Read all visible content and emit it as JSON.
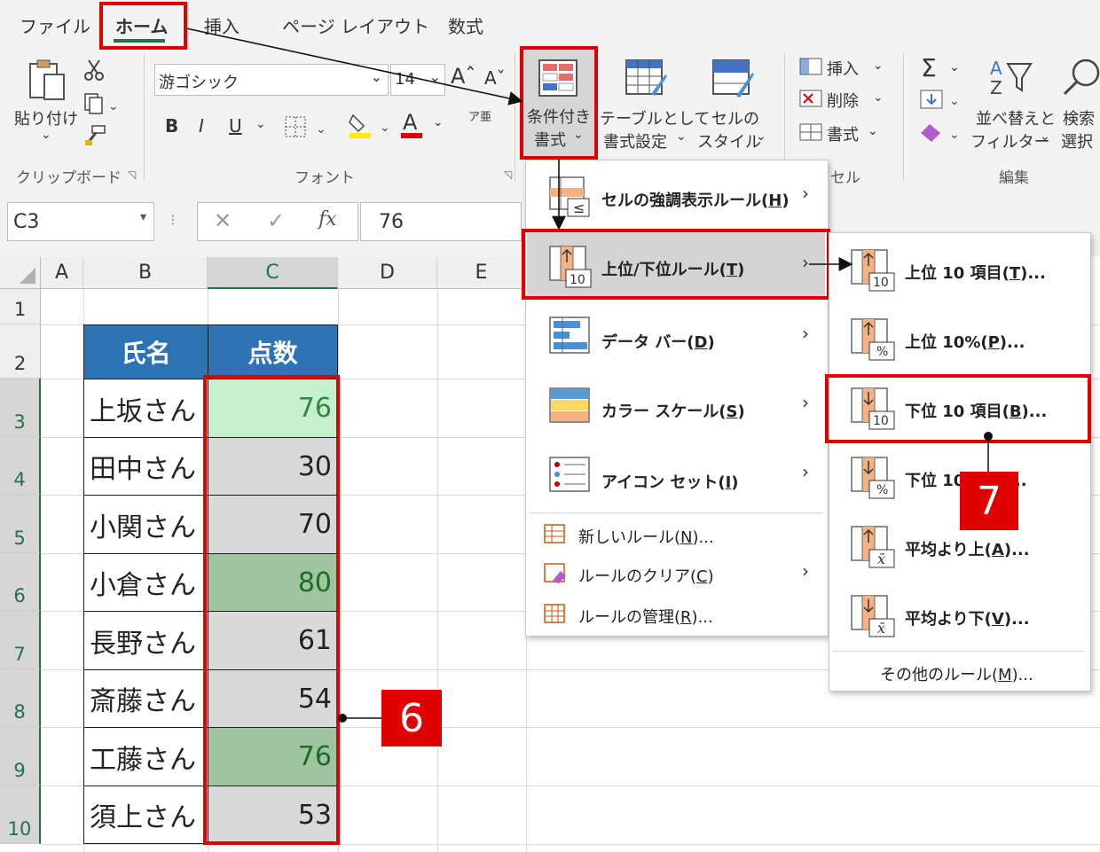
{
  "ribbon": {
    "tabs": [
      "ファイル",
      "ホーム",
      "挿入",
      "ページ レイアウト",
      "数式"
    ],
    "clipboard": {
      "paste_label": "貼り付け",
      "group_label": "クリップボード"
    },
    "font": {
      "font_name": "游ゴシック",
      "font_size": "14",
      "group_label": "フォント",
      "bold": "B",
      "italic": "I",
      "underline": "U",
      "font_color_letter": "A",
      "phonetic": "ア亜"
    },
    "styles": {
      "conditional_format_line1": "条件付き",
      "conditional_format_line2": "書式",
      "table_format_line1": "テーブルとして",
      "table_format_line2": "書式設定",
      "cell_style_line1": "セルの",
      "cell_style_line2": "スタイル"
    },
    "cells": {
      "insert": "挿入",
      "delete": "削除",
      "format": "書式",
      "group_label": "セル"
    },
    "editing": {
      "sort_line1": "並べ替えと",
      "sort_line2": "フィルター",
      "find_line1": "検索",
      "find_line2": "選択",
      "group_label": "編集"
    }
  },
  "formula_bar": {
    "name_box": "C3",
    "fx": "fx",
    "value": "76"
  },
  "columns": [
    "A",
    "B",
    "C",
    "D",
    "E"
  ],
  "rows": [
    "1",
    "2",
    "3",
    "4",
    "5",
    "6",
    "7",
    "8",
    "9",
    "10"
  ],
  "table": {
    "headers": [
      "氏名",
      "点数"
    ],
    "rows": [
      {
        "name": "上坂さん",
        "score": "76",
        "fill": "#c6efce",
        "font": "#2e8b3e"
      },
      {
        "name": "田中さん",
        "score": "30",
        "fill": "#d9d9d9",
        "font": "#222222"
      },
      {
        "name": "小関さん",
        "score": "70",
        "fill": "#d9d9d9",
        "font": "#222222"
      },
      {
        "name": "小倉さん",
        "score": "80",
        "fill": "#9fc5a0",
        "font": "#1e6b28"
      },
      {
        "name": "長野さん",
        "score": "61",
        "fill": "#d9d9d9",
        "font": "#222222"
      },
      {
        "name": "斎藤さん",
        "score": "54",
        "fill": "#d9d9d9",
        "font": "#222222"
      },
      {
        "name": "工藤さん",
        "score": "76",
        "fill": "#9fc5a0",
        "font": "#1e6b28"
      },
      {
        "name": "須上さん",
        "score": "53",
        "fill": "#d9d9d9",
        "font": "#222222"
      }
    ]
  },
  "cf_menu": {
    "items": [
      {
        "label": "セルの強調表示ルール(",
        "key": "H",
        "tail": ")"
      },
      {
        "label": "上位/下位ルール(",
        "key": "T",
        "tail": ")"
      },
      {
        "label": "データ バー(",
        "key": "D",
        "tail": ")"
      },
      {
        "label": "カラー スケール(",
        "key": "S",
        "tail": ")"
      },
      {
        "label": "アイコン セット(",
        "key": "I",
        "tail": ")"
      }
    ],
    "small_items": [
      {
        "label": "新しいルール(",
        "key": "N",
        "tail": ")..."
      },
      {
        "label": "ルールのクリア(",
        "key": "C",
        "tail": ")"
      },
      {
        "label": "ルールの管理(",
        "key": "R",
        "tail": ")..."
      }
    ]
  },
  "sub_menu": {
    "items": [
      {
        "label": "上位 10 項目(",
        "key": "T",
        "tail": ")...",
        "badge": "10"
      },
      {
        "label": "上位 10%(",
        "key": "P",
        "tail": ")...",
        "badge": "%"
      },
      {
        "label": "下位 10 項目(",
        "key": "B",
        "tail": ")...",
        "badge": "10"
      },
      {
        "label": "下位 10%(",
        "key": "O",
        "tail": ")...",
        "badge": "%"
      },
      {
        "label": "平均より上(",
        "key": "A",
        "tail": ")...",
        "badge": "x̄"
      },
      {
        "label": "平均より下(",
        "key": "V",
        "tail": ")...",
        "badge": "x̄"
      }
    ],
    "more": {
      "label": "その他のルール(",
      "key": "M",
      "tail": ")..."
    }
  },
  "callouts": {
    "step6": "6",
    "step7": "7"
  },
  "colors": {
    "accent_red": "#e00000",
    "excel_green": "#217346",
    "header_blue": "#2e74b5"
  },
  "icons": [
    "paste-icon",
    "cut-icon",
    "copy-icon",
    "format-painter-icon",
    "borders-icon",
    "fill-color-icon",
    "conditional-format-icon",
    "table-format-icon",
    "cell-styles-icon",
    "autosum-icon",
    "fill-icon",
    "clear-icon",
    "sort-filter-icon",
    "find-icon"
  ]
}
